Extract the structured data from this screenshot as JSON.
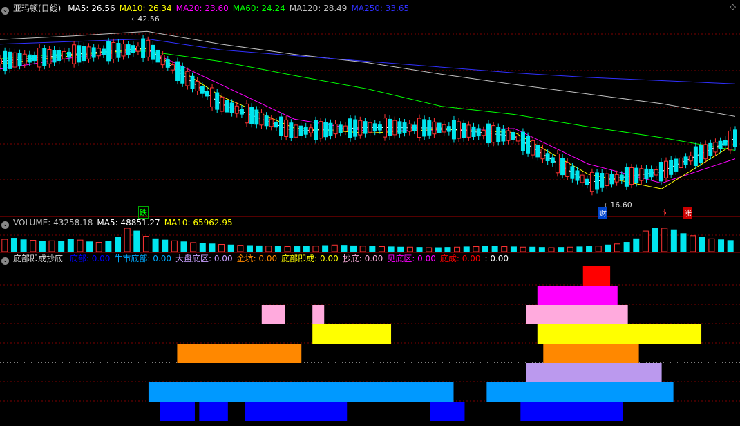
{
  "main_header": {
    "title": "亚玛顿(日线)",
    "indicators": [
      {
        "label": "MA5: 26.56",
        "color": "#ffffff"
      },
      {
        "label": "MA10: 26.34",
        "color": "#ffff00"
      },
      {
        "label": "MA20: 23.60",
        "color": "#ff00ff"
      },
      {
        "label": "MA60: 24.24",
        "color": "#00ff00"
      },
      {
        "label": "MA120: 28.49",
        "color": "#c0c0c0"
      },
      {
        "label": "MA250: 33.65",
        "color": "#3030ff"
      }
    ]
  },
  "volume_header": {
    "indicators": [
      {
        "label": "VOLUME: 43258.18",
        "color": "#c0c0c0"
      },
      {
        "label": "MA5: 48851.27",
        "color": "#ffffff"
      },
      {
        "label": "MA10: 65962.95",
        "color": "#ffff00"
      }
    ]
  },
  "bottom_header": {
    "title": "底部即成抄底",
    "indicators": [
      {
        "label": "底部: 0.00",
        "color": "#0000ff"
      },
      {
        "label": "牛市底部: 0.00",
        "color": "#00aaff"
      },
      {
        "label": "大盘底区: 0.00",
        "color": "#c8a0ff"
      },
      {
        "label": "金坑: 0.00",
        "color": "#ff8800"
      },
      {
        "label": "底部即成: 0.00",
        "color": "#ffff00"
      },
      {
        "label": "抄底: 0.00",
        "color": "#ffb0e0"
      },
      {
        "label": "见底区: 0.00",
        "color": "#ff00ff"
      },
      {
        "label": "底成: 0.00",
        "color": "#ff0000"
      },
      {
        "label": ": 0.00",
        "color": "#ffffff"
      }
    ]
  },
  "annotations": {
    "high": "42.56",
    "low": "16.60",
    "mark_1": "跌",
    "mark_2": "财",
    "mark_3": "$",
    "mark_4": "涨"
  },
  "colors": {
    "up": "#ff3333",
    "down": "#00e5ee",
    "grid": "#800000",
    "ma5": "#ffffff",
    "ma10": "#ffff00",
    "ma20": "#ff00ff",
    "ma60": "#00ff00",
    "ma120": "#c0c0c0",
    "ma250": "#3030ff"
  },
  "chart_data": [
    {
      "type": "line",
      "name": "price-ma",
      "ylim": [
        15,
        45
      ],
      "series": [
        {
          "name": "MA120",
          "x": [
            0,
            10,
            20,
            30,
            40,
            50,
            60,
            70,
            80,
            90,
            100
          ],
          "values": [
            41.2,
            41.8,
            42.5,
            40.5,
            38.9,
            37.6,
            35.8,
            34.2,
            32.7,
            31.2,
            29.2
          ]
        },
        {
          "name": "MA250",
          "x": [
            0,
            10,
            20,
            30,
            40,
            50,
            60,
            70,
            80,
            90,
            100
          ],
          "values": [
            40.5,
            40.9,
            41.3,
            39.6,
            38.7,
            37.8,
            36.9,
            36.0,
            35.3,
            34.8,
            34.3
          ]
        },
        {
          "name": "MA60",
          "x": [
            0,
            10,
            20,
            30,
            40,
            50,
            60,
            70,
            80,
            90,
            100
          ],
          "values": [
            38.2,
            39.1,
            39.4,
            37.8,
            35.6,
            33.5,
            30.8,
            29.5,
            27.6,
            25.9,
            23.9
          ]
        },
        {
          "name": "MA20",
          "x": [
            0,
            10,
            20,
            30,
            40,
            50,
            60,
            70,
            80,
            90,
            100
          ],
          "values": [
            36.6,
            38.4,
            39.6,
            34.2,
            28.8,
            26.9,
            27.1,
            27.3,
            21.8,
            18.8,
            22.6
          ]
        },
        {
          "name": "MA10",
          "x": [
            0,
            10,
            20,
            30,
            40,
            50,
            60,
            70,
            80,
            90,
            100
          ],
          "values": [
            37.4,
            38.7,
            39.8,
            32.4,
            27.4,
            26.6,
            27.2,
            26.7,
            20.2,
            17.9,
            25.0
          ]
        },
        {
          "name": "MA5",
          "x": [
            0,
            10,
            20,
            30,
            40,
            50,
            60,
            70,
            80,
            90,
            100
          ],
          "values": [
            37.8,
            38.9,
            39.9,
            31.2,
            26.9,
            27.5,
            27.4,
            26.1,
            18.9,
            20.6,
            25.8
          ]
        }
      ]
    },
    {
      "type": "bar",
      "name": "volume",
      "ylim": [
        0,
        200000
      ],
      "values": [
        48000,
        52000,
        46000,
        44000,
        39000,
        42000,
        41000,
        47000,
        45000,
        38000,
        36000,
        40000,
        55000,
        120000,
        80000,
        60000,
        50000,
        45000,
        42000,
        38000,
        35000,
        33000,
        30000,
        28000,
        26000,
        25000,
        24000,
        23000,
        22000,
        21000,
        20000,
        20000,
        21000,
        22000,
        24000,
        26000,
        25000,
        23000,
        22000,
        21000,
        20000,
        19000,
        18000,
        18000,
        17000,
        16000,
        16000,
        17000,
        18000,
        19000,
        20000,
        21000,
        22000,
        20000,
        19000,
        18000,
        18000,
        17000,
        16000,
        17000,
        18000,
        19000,
        20000,
        22000,
        26000,
        30000,
        36000,
        50000,
        80000,
        105000,
        98000,
        85000,
        70000,
        62000,
        55000,
        50000,
        46000,
        43258
      ]
    },
    {
      "type": "bar",
      "name": "bottom-signals",
      "categories": [
        "底成",
        "见底区",
        "抄底",
        "底部即成",
        "金坑",
        "大盘底区",
        "牛市底部",
        "底部"
      ],
      "x_range": [
        0,
        100
      ],
      "series": [
        {
          "name": "底成",
          "segments": [
            [
              79.3,
              83.0
            ]
          ]
        },
        {
          "name": "见底区",
          "segments": [
            [
              73.1,
              84.0
            ]
          ]
        },
        {
          "name": "抄底",
          "segments": [
            [
              35.6,
              38.8
            ],
            [
              42.5,
              44.1
            ],
            [
              71.6,
              85.4
            ]
          ]
        },
        {
          "name": "底部即成",
          "segments": [
            [
              42.5,
              53.2
            ],
            [
              73.1,
              95.4
            ]
          ]
        },
        {
          "name": "金坑",
          "segments": [
            [
              24.1,
              41.0
            ],
            [
              73.9,
              86.9
            ]
          ]
        },
        {
          "name": "大盘底区",
          "segments": [
            [
              71.6,
              90.0
            ]
          ]
        },
        {
          "name": "牛市底部",
          "segments": [
            [
              20.2,
              61.7
            ],
            [
              66.2,
              91.6
            ]
          ]
        },
        {
          "name": "底部",
          "segments": [
            [
              21.8,
              26.5
            ],
            [
              27.1,
              31.0
            ],
            [
              33.3,
              47.2
            ],
            [
              58.5,
              63.2
            ],
            [
              70.8,
              84.7
            ]
          ]
        }
      ]
    }
  ]
}
